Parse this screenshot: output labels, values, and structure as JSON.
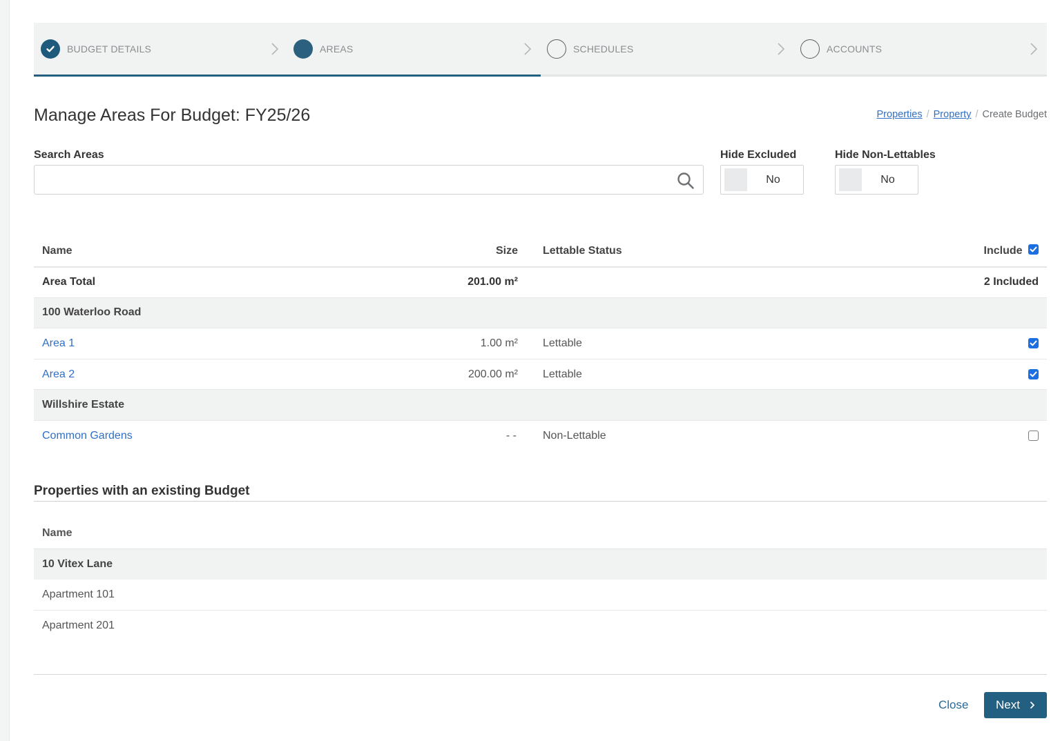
{
  "wizard": {
    "steps": [
      {
        "label": "BUDGET DETAILS",
        "state": "done"
      },
      {
        "label": "AREAS",
        "state": "active"
      },
      {
        "label": "SCHEDULES",
        "state": "todo"
      },
      {
        "label": "ACCOUNTS",
        "state": "todo"
      }
    ],
    "progress_fraction": 0.5,
    "accent_color": "#245f80"
  },
  "page": {
    "title": "Manage Areas For Budget: FY25/26"
  },
  "breadcrumb": {
    "items": [
      "Properties",
      "Property"
    ],
    "current": "Create Budget",
    "separator": "/"
  },
  "search": {
    "label": "Search Areas",
    "value": "",
    "icon": "search-icon"
  },
  "filters": {
    "hide_excluded": {
      "label": "Hide Excluded",
      "value": "No"
    },
    "hide_non_lettables": {
      "label": "Hide Non-Lettables",
      "value": "No"
    }
  },
  "areas_table": {
    "columns": {
      "name": "Name",
      "size": "Size",
      "lettable_status": "Lettable Status",
      "include": "Include"
    },
    "include_all_checked": true,
    "total": {
      "name": "Area Total",
      "size": "201.00 m²",
      "included": "2 Included"
    },
    "groups": [
      {
        "name": "100 Waterloo Road",
        "rows": [
          {
            "name": "Area 1",
            "size": "1.00 m²",
            "status": "Lettable",
            "included": true
          },
          {
            "name": "Area 2",
            "size": "200.00 m²",
            "status": "Lettable",
            "included": true
          }
        ]
      },
      {
        "name": "Willshire Estate",
        "rows": [
          {
            "name": "Common Gardens",
            "size": "- -",
            "status": "Non-Lettable",
            "included": false
          }
        ]
      }
    ]
  },
  "existing_budget": {
    "title": "Properties with an existing Budget",
    "column": "Name",
    "group": "10 Vitex Lane",
    "rows": [
      "Apartment 101",
      "Apartment 201"
    ]
  },
  "footer": {
    "close_label": "Close",
    "next_label": "Next",
    "next_icon": "chevron-right-icon"
  }
}
